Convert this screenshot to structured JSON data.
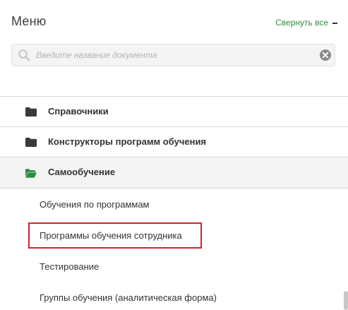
{
  "header": {
    "title": "Меню",
    "collapse_all_label": "Свернуть все"
  },
  "search": {
    "placeholder": "Введите название документа",
    "value": ""
  },
  "sections": [
    {
      "label": "Справочники",
      "expanded": false,
      "icon": "folder-icon"
    },
    {
      "label": "Конструкторы программ обучения",
      "expanded": false,
      "icon": "folder-icon"
    },
    {
      "label": "Самообучение",
      "expanded": true,
      "icon": "folder-open-icon"
    }
  ],
  "subitems": [
    {
      "label": "Обучения по программам"
    },
    {
      "label": "Программы обучения сотрудника",
      "highlighted": true
    },
    {
      "label": "Тестирование"
    },
    {
      "label": "Группы обучения (аналитическая форма)"
    }
  ],
  "colors": {
    "accent_green": "#2e8b3d",
    "highlight_red": "#d0242f",
    "folder_dark": "#3a3a3a"
  }
}
